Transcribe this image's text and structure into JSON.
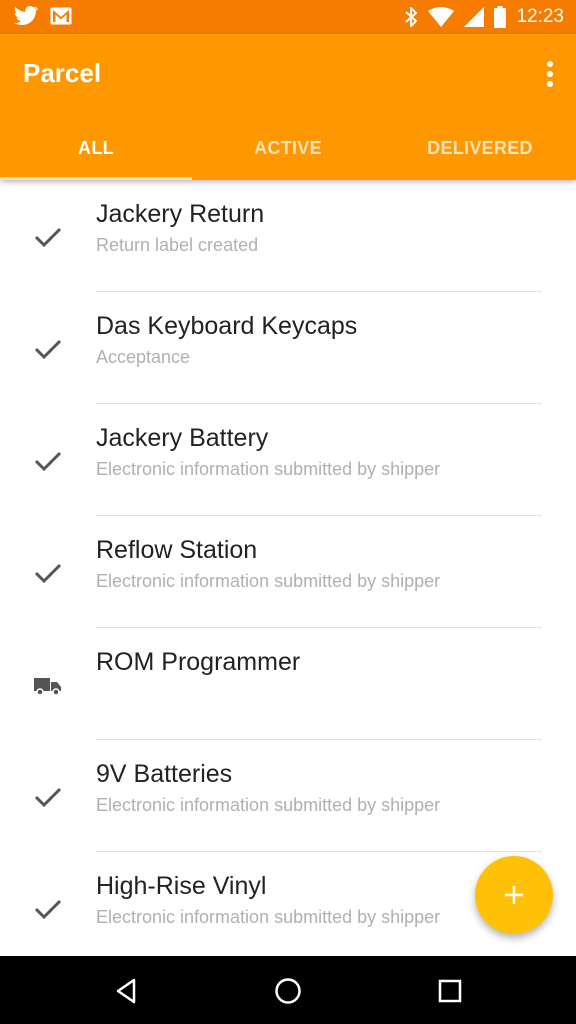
{
  "status_bar": {
    "time": "12:23",
    "left_icons": [
      "twitter-icon",
      "gmail-icon"
    ],
    "right_icons": [
      "bluetooth-icon",
      "wifi-icon",
      "cell-signal-icon",
      "battery-icon"
    ]
  },
  "app_bar": {
    "title": "Parcel",
    "menu_icon": "more-vert-icon"
  },
  "tabs": [
    {
      "label": "ALL",
      "active": true
    },
    {
      "label": "ACTIVE",
      "active": false
    },
    {
      "label": "DELIVERED",
      "active": false
    }
  ],
  "parcels": [
    {
      "title": "Jackery Return",
      "status": "Return label created",
      "icon": "check-icon"
    },
    {
      "title": "Das Keyboard Keycaps",
      "status": "Acceptance",
      "icon": "check-icon"
    },
    {
      "title": "Jackery Battery",
      "status": "Electronic information submitted by shipper",
      "icon": "check-icon"
    },
    {
      "title": "Reflow Station",
      "status": "Electronic information submitted by shipper",
      "icon": "check-icon"
    },
    {
      "title": "ROM Programmer",
      "status": "",
      "icon": "truck-icon"
    },
    {
      "title": "9V Batteries",
      "status": "Electronic information submitted by shipper",
      "icon": "check-icon"
    },
    {
      "title": "High-Rise Vinyl",
      "status": "Electronic information submitted by shipper",
      "icon": "check-icon"
    }
  ],
  "fab": {
    "icon": "plus-icon"
  },
  "nav_bar": {
    "icons": [
      "back-icon",
      "home-icon",
      "recents-icon"
    ]
  },
  "colors": {
    "status_bar": "#F57C00",
    "app_bar": "#FF9800",
    "fab": "#FFC107",
    "title_text": "#222222",
    "subtitle_text": "#B0B0B0",
    "icon": "#555555"
  }
}
